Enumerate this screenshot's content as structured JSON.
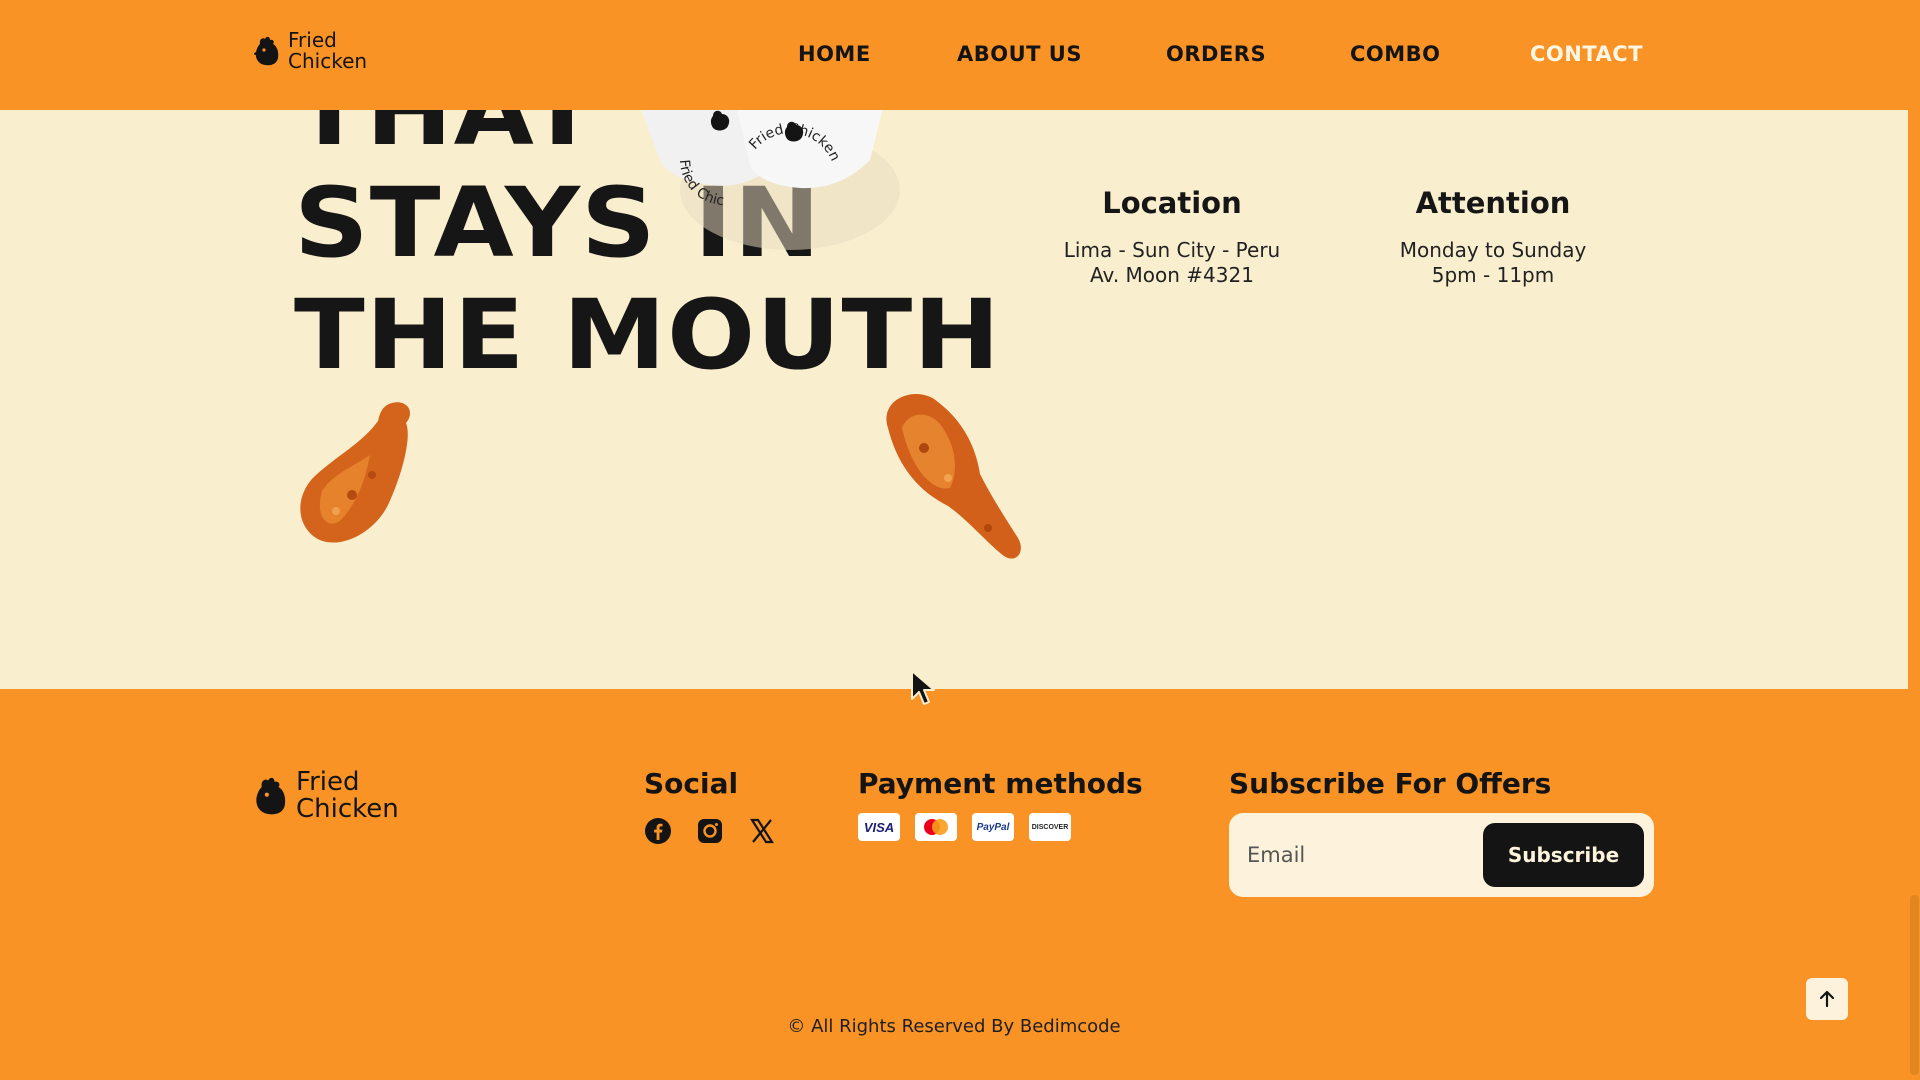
{
  "header": {
    "logo": {
      "line1": "Fried",
      "line2": "Chicken",
      "icon": "chicken-head-icon"
    },
    "nav": [
      {
        "label": "HOME",
        "active": false
      },
      {
        "label": "ABOUT US",
        "active": false
      },
      {
        "label": "ORDERS",
        "active": false
      },
      {
        "label": "COMBO",
        "active": false
      },
      {
        "label": "CONTACT",
        "active": true
      }
    ]
  },
  "hero": {
    "headline": [
      "THAT",
      "STAYS IN",
      "THE MOUTH"
    ],
    "cup_label": "Fried Chicken",
    "location": {
      "title": "Location",
      "line1": "Lima - Sun City - Peru",
      "line2": "Av. Moon #4321"
    },
    "attention": {
      "title": "Attention",
      "line1": "Monday to Sunday",
      "line2": "5pm - 11pm"
    }
  },
  "footer": {
    "logo": {
      "line1": "Fried",
      "line2": "Chicken"
    },
    "social": {
      "title": "Social",
      "icons": [
        "facebook-icon",
        "instagram-icon",
        "x-icon"
      ]
    },
    "payment": {
      "title": "Payment methods",
      "cards": [
        "VISA",
        "mastercard",
        "PayPal",
        "DISCOVER"
      ]
    },
    "subscribe": {
      "title": "Subscribe For Offers",
      "placeholder": "Email",
      "button": "Subscribe"
    },
    "copyright": "© All Rights Reserved By Bedimcode",
    "back_to_top_icon": "arrow-up-icon"
  },
  "colors": {
    "orange": "#f99325",
    "cream": "#f9efcf",
    "dark": "#141414",
    "active_nav": "#fff6e4"
  }
}
